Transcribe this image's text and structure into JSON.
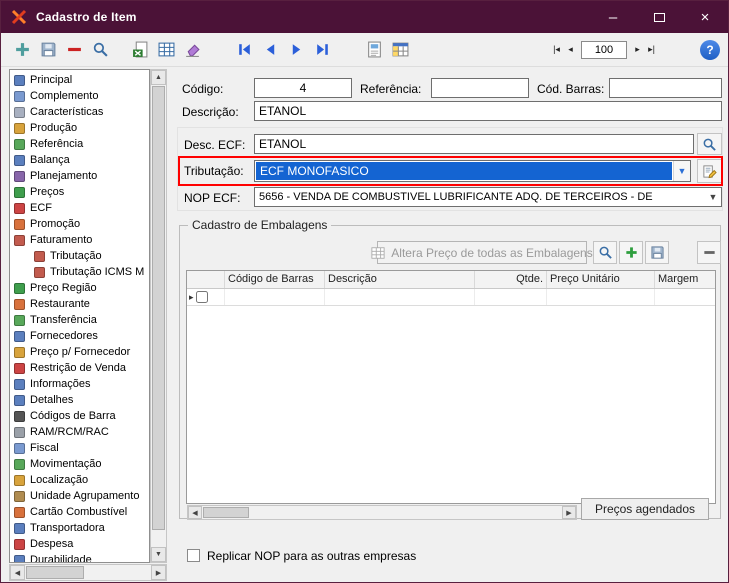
{
  "window": {
    "title": "Cadastro de Item",
    "minimize_label": "–",
    "close_label": "×"
  },
  "toolbar": {
    "buttons": [
      "add",
      "save",
      "delete",
      "search",
      "export-grid",
      "table",
      "clear",
      "first-record",
      "prior-record",
      "next-record",
      "last-record",
      "report",
      "summary-table"
    ],
    "record_count": "100",
    "help_label": "?"
  },
  "sidebar": {
    "items": [
      {
        "label": "Principal",
        "icon": "form-icon",
        "level": 0
      },
      {
        "label": "Complemento",
        "icon": "attach-icon",
        "level": 0
      },
      {
        "label": "Características",
        "icon": "edit-icon",
        "level": 0
      },
      {
        "label": "Produção",
        "icon": "production-icon",
        "level": 0
      },
      {
        "label": "Referência",
        "icon": "reference-icon",
        "level": 0
      },
      {
        "label": "Balança",
        "icon": "scale-icon",
        "level": 0
      },
      {
        "label": "Planejamento",
        "icon": "planning-icon",
        "level": 0
      },
      {
        "label": "Preços",
        "icon": "price-icon",
        "level": 0
      },
      {
        "label": "ECF",
        "icon": "ecf-icon",
        "level": 0
      },
      {
        "label": "Promoção",
        "icon": "promo-icon",
        "level": 0
      },
      {
        "label": "Faturamento",
        "icon": "billing-icon",
        "level": 0
      },
      {
        "label": "Tributação",
        "icon": "tax-icon",
        "level": 1
      },
      {
        "label": "Tributação ICMS M",
        "icon": "tax-icon",
        "level": 1
      },
      {
        "label": "Preço Região",
        "icon": "region-price-icon",
        "level": 0
      },
      {
        "label": "Restaurante",
        "icon": "restaurant-icon",
        "level": 0
      },
      {
        "label": "Transferência",
        "icon": "transfer-icon",
        "level": 0
      },
      {
        "label": "Fornecedores",
        "icon": "suppliers-icon",
        "level": 0
      },
      {
        "label": "Preço p/ Fornecedor",
        "icon": "supplier-price-icon",
        "level": 0
      },
      {
        "label": "Restrição de Venda",
        "icon": "restriction-icon",
        "level": 0
      },
      {
        "label": "Informações",
        "icon": "info-icon",
        "level": 0
      },
      {
        "label": "Detalhes",
        "icon": "details-icon",
        "level": 0
      },
      {
        "label": "Códigos de Barra",
        "icon": "barcode-icon",
        "level": 0
      },
      {
        "label": "RAM/RCM/RAC",
        "icon": "ram-icon",
        "level": 0
      },
      {
        "label": "Fiscal",
        "icon": "fiscal-icon",
        "level": 0
      },
      {
        "label": "Movimentação",
        "icon": "movement-icon",
        "level": 0
      },
      {
        "label": "Localização",
        "icon": "location-icon",
        "level": 0
      },
      {
        "label": "Unidade Agrupamento",
        "icon": "unit-icon",
        "level": 0
      },
      {
        "label": "Cartão Combustível",
        "icon": "fuel-card-icon",
        "level": 0
      },
      {
        "label": "Transportadora",
        "icon": "carrier-icon",
        "level": 0
      },
      {
        "label": "Despesa",
        "icon": "expense-icon",
        "level": 0
      },
      {
        "label": "Durabilidade",
        "icon": "durability-icon",
        "level": 0
      }
    ]
  },
  "form": {
    "codigo": {
      "label": "Código:",
      "value": "4"
    },
    "referencia": {
      "label": "Referência:",
      "value": ""
    },
    "cod_barras": {
      "label": "Cód. Barras:",
      "value": ""
    },
    "descricao": {
      "label": "Descrição:",
      "value": "ETANOL"
    },
    "desc_ecf": {
      "label": "Desc. ECF:",
      "value": "ETANOL"
    },
    "tributacao": {
      "label": "Tributação:",
      "value": "ECF MONOFASICO"
    },
    "nop_ecf": {
      "label": "NOP ECF:",
      "value": "5656 - VENDA DE COMBUSTIVEL LUBRIFICANTE ADQ. DE TERCEIROS - DE"
    }
  },
  "embalagens": {
    "title": "Cadastro de Embalagens",
    "alter_price_button": "Altera Preço de todas as Embalagens",
    "columns": [
      "",
      "Código de Barras",
      "Descrição",
      "Qtde.",
      "Preço Unitário",
      "Margem"
    ],
    "precos_agendados_button": "Preços agendados"
  },
  "footer": {
    "replicar_label": "Replicar NOP para as outras empresas"
  },
  "colors": {
    "titlebar": "#4B1237",
    "selection": "#1464D2",
    "annotation": "#FF0000"
  }
}
